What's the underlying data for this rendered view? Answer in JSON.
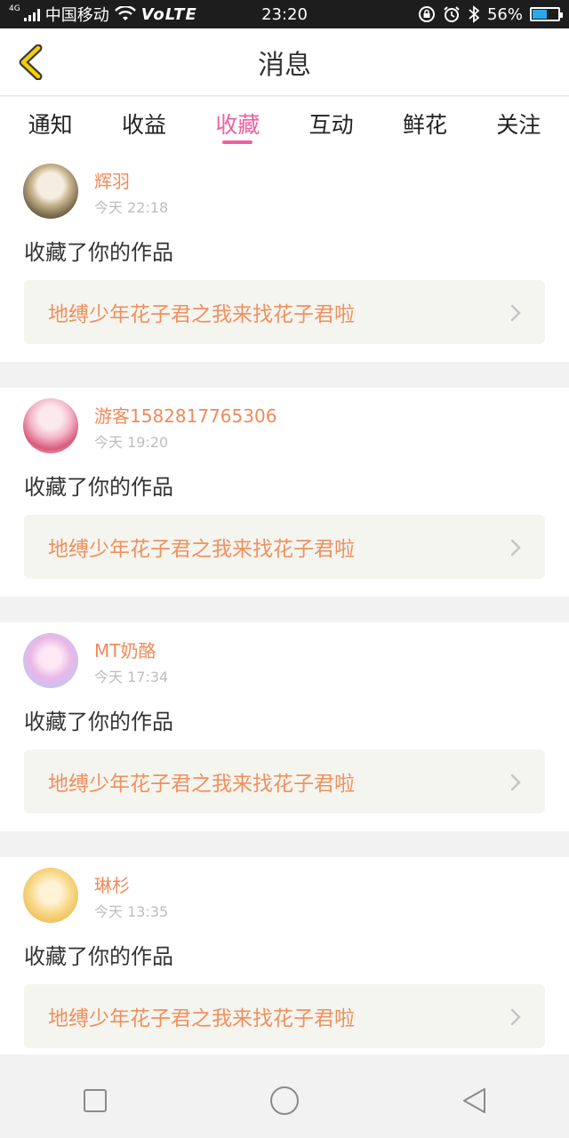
{
  "status_bar": {
    "network_tag": "4G",
    "carrier": "中国移动",
    "volte": "VoLTE",
    "time": "23:20",
    "battery_percent": "56%",
    "battery_level": 0.56,
    "icons": [
      "signal-icon",
      "wifi-icon",
      "lock-rotate-icon",
      "alarm-icon",
      "bluetooth-icon",
      "battery-icon"
    ]
  },
  "header": {
    "title": "消息",
    "back_icon": "chevron-left-icon",
    "accent": "#f5d000"
  },
  "tabs": [
    {
      "label": "通知",
      "active": false
    },
    {
      "label": "收益",
      "active": false
    },
    {
      "label": "收藏",
      "active": true
    },
    {
      "label": "互动",
      "active": false
    },
    {
      "label": "鲜花",
      "active": false
    },
    {
      "label": "关注",
      "active": false
    }
  ],
  "colors": {
    "active_tab": "#f0609e",
    "username": "#f08a5a",
    "work_title": "#f0905e"
  },
  "items": [
    {
      "username": "辉羽",
      "time": "今天 22:18",
      "action": "收藏了你的作品",
      "work": "地缚少年花子君之我来找花子君啦"
    },
    {
      "username": "游客1582817765306",
      "time": "今天 19:20",
      "action": "收藏了你的作品",
      "work": "地缚少年花子君之我来找花子君啦"
    },
    {
      "username": "MT奶酪",
      "time": "今天 17:34",
      "action": "收藏了你的作品",
      "work": "地缚少年花子君之我来找花子君啦"
    },
    {
      "username": "琳杉",
      "time": "今天 13:35",
      "action": "收藏了你的作品",
      "work": "地缚少年花子君之我来找花子君啦"
    }
  ],
  "nav": {
    "icons": [
      "square-recent-icon",
      "circle-home-icon",
      "triangle-back-icon"
    ]
  }
}
